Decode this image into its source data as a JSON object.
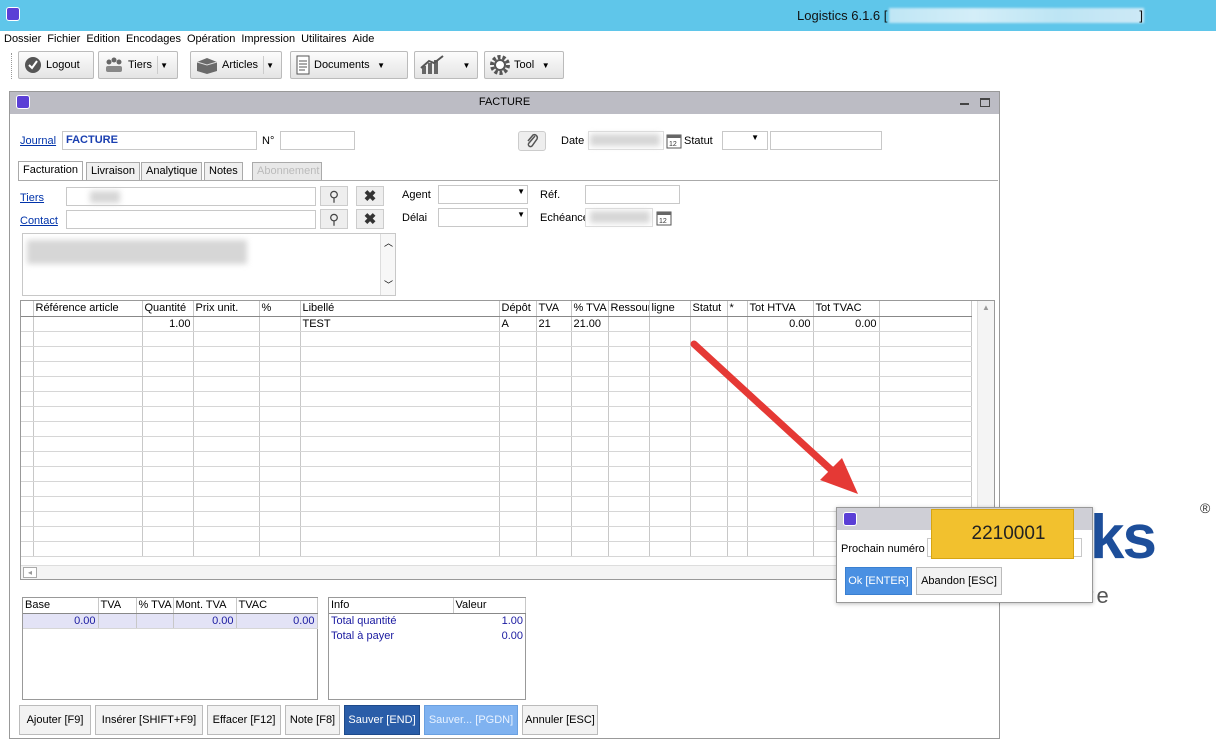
{
  "app": {
    "title": "Logistics 6.1.6 [",
    "title_suffix": "]"
  },
  "menu": [
    "Dossier",
    "Fichier",
    "Edition",
    "Encodages",
    "Opération",
    "Impression",
    "Utilitaires",
    "Aide"
  ],
  "toolbar": {
    "logout": "Logout",
    "tiers": "Tiers",
    "articles": "Articles",
    "documents": "Documents",
    "tool": "Tool"
  },
  "window": {
    "title": "FACTURE"
  },
  "header": {
    "journal_label": "Journal",
    "journal_value": "FACTURE",
    "no_label": "N°",
    "date_label": "Date",
    "statut_label": "Statut"
  },
  "tabs": [
    "Facturation",
    "Livraison",
    "Analytique",
    "Notes",
    "Abonnement"
  ],
  "form": {
    "tiers_label": "Tiers",
    "contact_label": "Contact",
    "agent_label": "Agent",
    "delai_label": "Délai",
    "ref_label": "Réf.",
    "echeance_label": "Echéance"
  },
  "grid": {
    "columns": [
      "Référence article",
      "Quantité",
      "Prix unit.",
      "%",
      "Libellé",
      "Dépôt",
      "TVA",
      "% TVA",
      "Ressource",
      "ligne",
      "Statut",
      "*",
      "Tot HTVA",
      "Tot TVAC"
    ],
    "row": {
      "qty": "1.00",
      "libelle": "TEST",
      "depot": "A",
      "tva": "21",
      "pct_tva": "21.00",
      "tot_htva": "0.00",
      "tot_tvac": "0.00"
    }
  },
  "tva_table": {
    "columns": [
      "Base",
      "TVA",
      "% TVA",
      "Mont. TVA",
      "TVAC"
    ],
    "row": {
      "base": "0.00",
      "mont": "0.00",
      "tvac": "0.00"
    }
  },
  "info_table": {
    "columns": [
      "Info",
      "Valeur"
    ],
    "rows": [
      {
        "label": "Total quantité",
        "value": "1.00"
      },
      {
        "label": "Total à payer",
        "value": "0.00"
      }
    ]
  },
  "buttons": {
    "ajouter": "Ajouter [F9]",
    "inserer": "Insérer [SHIFT+F9]",
    "effacer": "Effacer [F12]",
    "note": "Note [F8]",
    "sauver": "Sauver [END]",
    "sauver_pgdn": "Sauver... [PGDN]",
    "annuler": "Annuler [ESC]"
  },
  "dialog": {
    "label": "Prochain numéro",
    "value": "2210001",
    "ok": "Ok [ENTER]",
    "cancel": "Abandon [ESC]"
  },
  "background_logo": {
    "letters": "ks",
    "registered": "®",
    "tagline": "ware"
  },
  "colors": {
    "titlebar": "#5fc6ea",
    "primary_button": "#2a5da8",
    "disabled_button": "#7fb2f0",
    "dialog_ok": "#4a90e2",
    "callout": "#f2c12e",
    "arrow": "#e53935",
    "link": "#0033aa"
  }
}
